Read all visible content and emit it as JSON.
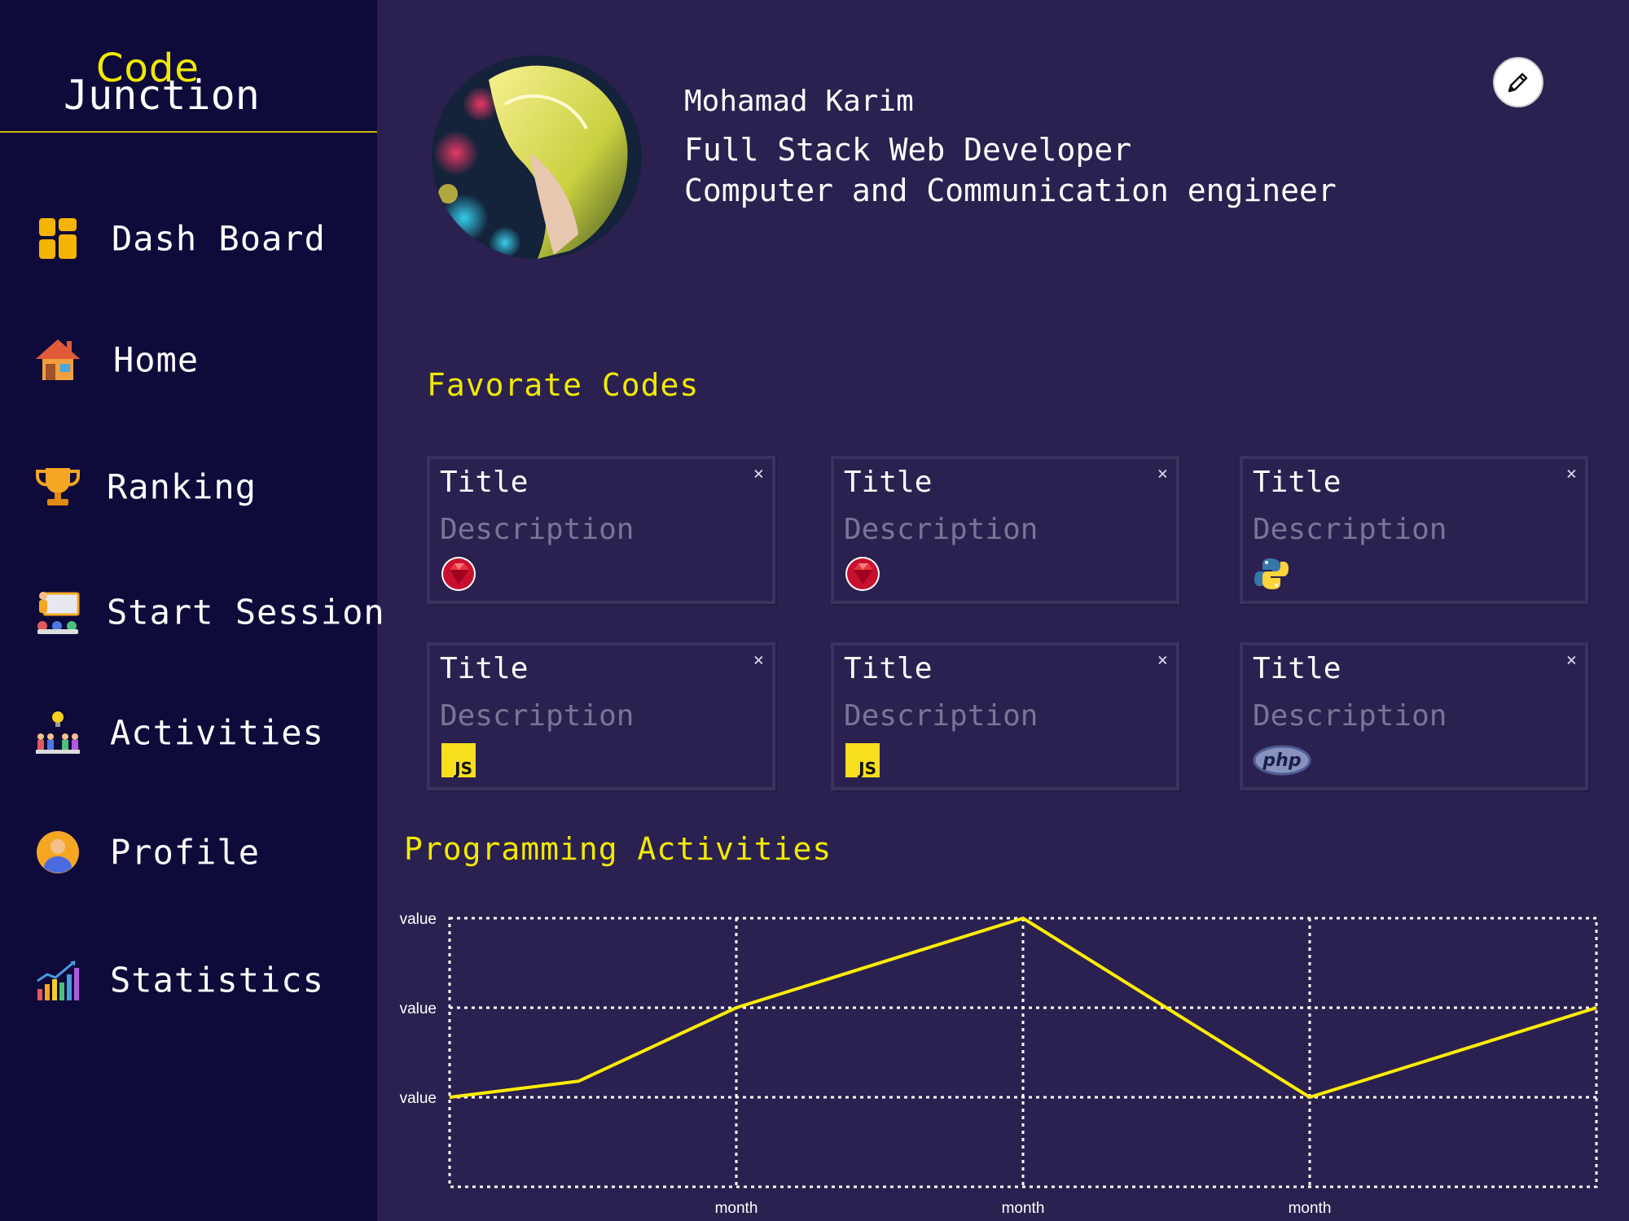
{
  "logo": {
    "line1": "Code",
    "line2": "Junction"
  },
  "sidebar": {
    "items": [
      {
        "label": "Dash Board",
        "icon": "dashboard-icon"
      },
      {
        "label": "Home",
        "icon": "house-icon"
      },
      {
        "label": "Ranking",
        "icon": "trophy-icon"
      },
      {
        "label": "Start Session",
        "icon": "presentation-icon"
      },
      {
        "label": "Activities",
        "icon": "team-idea-icon"
      },
      {
        "label": "Profile",
        "icon": "user-avatar-icon"
      },
      {
        "label": "Statistics",
        "icon": "bar-chart-icon"
      }
    ]
  },
  "profile": {
    "name": "Mohamad Karim",
    "role": "Full Stack Web Developer",
    "degree": "Computer and Communication engineer",
    "edit_icon": "pencil-icon"
  },
  "favorites": {
    "heading": "Favorate Codes",
    "cards": [
      {
        "title": "Title",
        "description": "Description",
        "language": "ruby"
      },
      {
        "title": "Title",
        "description": "Description",
        "language": "ruby"
      },
      {
        "title": "Title",
        "description": "Description",
        "language": "python"
      },
      {
        "title": "Title",
        "description": "Description",
        "language": "javascript"
      },
      {
        "title": "Title",
        "description": "Description",
        "language": "javascript"
      },
      {
        "title": "Title",
        "description": "Description",
        "language": "php"
      }
    ],
    "close_glyph": "×",
    "js_text": "JS",
    "php_text": "php"
  },
  "activities": {
    "heading": "Programming Activities"
  },
  "colors": {
    "sidebar_bg": "#0e0a3a",
    "main_bg": "#2b2150",
    "accent_yellow": "#f2ea00",
    "line_color": "#ffee00"
  },
  "chart_data": {
    "type": "line",
    "x_ticks": [
      "month",
      "month",
      "month"
    ],
    "y_ticks": [
      "value",
      "value",
      "value"
    ],
    "series": [
      {
        "values": [
          1.0,
          1.18,
          2.0,
          3.0,
          1.0,
          2.0
        ]
      }
    ],
    "x": [
      0,
      0.45,
      1,
      2,
      3,
      4
    ],
    "xlim": [
      0,
      4
    ],
    "ylim": [
      0,
      3
    ],
    "grid": true,
    "title": "",
    "xlabel": "",
    "ylabel": ""
  }
}
